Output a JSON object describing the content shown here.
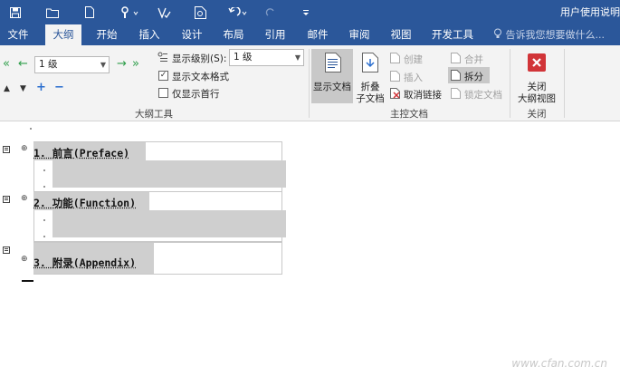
{
  "window": {
    "title": "用户使用说明"
  },
  "tabs": [
    {
      "label": "文件"
    },
    {
      "label": "大纲"
    },
    {
      "label": "开始"
    },
    {
      "label": "插入"
    },
    {
      "label": "设计"
    },
    {
      "label": "布局"
    },
    {
      "label": "引用"
    },
    {
      "label": "邮件"
    },
    {
      "label": "审阅"
    },
    {
      "label": "视图"
    },
    {
      "label": "开发工具"
    }
  ],
  "active_tab": "大纲",
  "tell_me": {
    "text": "告诉我您想要做什么..."
  },
  "outline_tools": {
    "level_value": "1 级",
    "show_level_label": "显示级别(S):",
    "show_level_value": "1 级",
    "show_text_format": "显示文本格式",
    "show_first_line": "仅显示首行",
    "group_label": "大纲工具"
  },
  "master_doc": {
    "show_document": "显示文档",
    "collapse_subdoc_1": "折叠",
    "collapse_subdoc_2": "子文档",
    "create": "创建",
    "insert": "插入",
    "unlink": "取消链接",
    "merge": "合并",
    "split": "拆分",
    "lock_document": "锁定文档",
    "group_label": "主控文档"
  },
  "close_group": {
    "close_label_1": "关闭",
    "close_label_2": "大纲视图",
    "group_label": "关闭"
  },
  "document": {
    "headings": [
      {
        "text": "1. 前言(Preface)"
      },
      {
        "text": "2. 功能(Function)"
      },
      {
        "text": "3. 附录(Appendix)"
      }
    ]
  },
  "watermark": "www.cfan.com.cn",
  "colors": {
    "brand": "#2b579a",
    "close_red": "#d13438",
    "highlight": "#cfcfcf"
  }
}
